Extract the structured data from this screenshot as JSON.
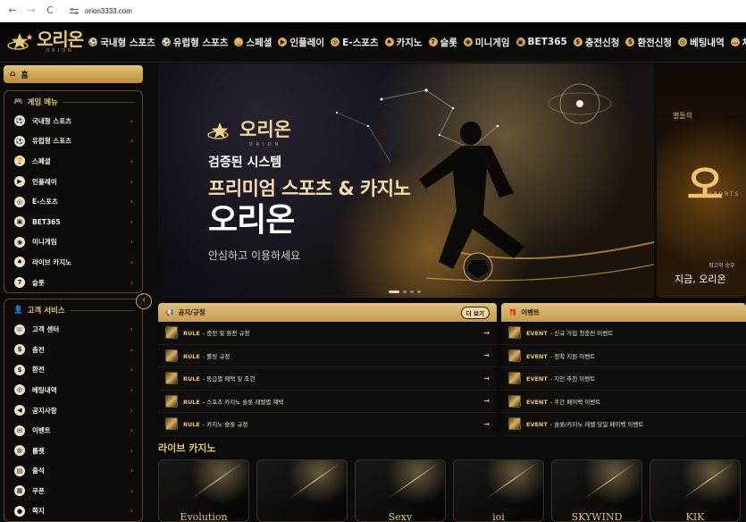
{
  "browser": {
    "url": "orion3333.com",
    "back_icon": "←",
    "forward_icon": "→",
    "reload_icon": "C"
  },
  "header": {
    "logo_ko": "오리온",
    "logo_en": "ORION",
    "menu": [
      {
        "label": "국내형 스포츠",
        "icon": "soccer-ball-icon",
        "glyph": "⚽"
      },
      {
        "label": "유럽형 스포츠",
        "icon": "soccer-ball-icon",
        "glyph": "⚽"
      },
      {
        "label": "스페셜",
        "icon": "trophy-icon",
        "glyph": "🏆"
      },
      {
        "label": "인플레이",
        "icon": "play-icon",
        "glyph": "▶"
      },
      {
        "label": "E-스포츠",
        "icon": "globe-icon",
        "glyph": "◎"
      },
      {
        "label": "카지노",
        "icon": "card-icon",
        "glyph": "♠"
      },
      {
        "label": "슬롯",
        "icon": "seven-icon",
        "glyph": "7"
      },
      {
        "label": "미니게임",
        "icon": "target-icon",
        "glyph": "◉"
      },
      {
        "label": "BET365",
        "icon": "bet365-icon",
        "glyph": "▣"
      },
      {
        "label": "충전신청",
        "icon": "coin-icon",
        "glyph": "$"
      },
      {
        "label": "환전신청",
        "icon": "coin-icon",
        "glyph": "$"
      },
      {
        "label": "베팅내역",
        "icon": "history-icon",
        "glyph": "◎"
      },
      {
        "label": "채",
        "icon": "chat-icon",
        "glyph": "…"
      }
    ]
  },
  "sidebar": {
    "home_label": "홈",
    "game_menu": {
      "title": "게임 메뉴",
      "items": [
        {
          "label": "국내형 스포츠",
          "glyph": "⚽"
        },
        {
          "label": "유럽형 스포츠",
          "glyph": "⚽"
        },
        {
          "label": "스페셜",
          "glyph": "🏆"
        },
        {
          "label": "인플레이",
          "glyph": "▶"
        },
        {
          "label": "E-스포츠",
          "glyph": "◎"
        },
        {
          "label": "BET365",
          "glyph": "▣"
        },
        {
          "label": "미니게임",
          "glyph": "◉"
        },
        {
          "label": "라이브 카지노",
          "glyph": "♠"
        },
        {
          "label": "슬롯",
          "glyph": "7"
        }
      ]
    },
    "service_menu": {
      "title": "고객 서비스",
      "items": [
        {
          "label": "고객 센터",
          "glyph": "☏"
        },
        {
          "label": "충전",
          "glyph": "$"
        },
        {
          "label": "환전",
          "glyph": "$"
        },
        {
          "label": "베팅내역",
          "glyph": "◎"
        },
        {
          "label": "공지사항",
          "glyph": "◀"
        },
        {
          "label": "이벤트",
          "glyph": "✉"
        },
        {
          "label": "룰렛",
          "glyph": "◍"
        },
        {
          "label": "출석",
          "glyph": "▤"
        },
        {
          "label": "쿠폰",
          "glyph": "▦"
        },
        {
          "label": "쪽지",
          "glyph": "●"
        }
      ]
    },
    "chevron": "›",
    "collapse_icon": "‹"
  },
  "hero": {
    "logo_ko": "오리온",
    "logo_en": "ORION",
    "line1": "검증된 시스템",
    "line2": "프리미엄 스포츠 & 카지노",
    "line3": "오리온",
    "line4": "안심하고 이용하세요",
    "next_slide": {
      "line1": "별들의",
      "big": "오",
      "sports": "SPORTS",
      "line3": "최고의 승부",
      "line4": "지금, 오리온"
    }
  },
  "notice": {
    "title": "공지/규정",
    "more": "더 보기",
    "items": [
      {
        "tag": "RULE",
        "title": "- 충전 및 환전 규정"
      },
      {
        "tag": "RULE",
        "title": "- 롤링 규정"
      },
      {
        "tag": "RULE",
        "title": "- 등급별 혜택 및 조건"
      },
      {
        "tag": "RULE",
        "title": "- 스포츠 카지노 슬롯 레벨별 혜택"
      },
      {
        "tag": "RULE",
        "title": "- 카지노 슬롯 규정"
      }
    ]
  },
  "events": {
    "title": "이벤트",
    "items": [
      {
        "tag": "EVENT",
        "title": "- 신규 가입 첫충전 이벤트"
      },
      {
        "tag": "EVENT",
        "title": "- 정착 지원 이벤트"
      },
      {
        "tag": "EVENT",
        "title": "- 지인 추천 이벤트"
      },
      {
        "tag": "EVENT",
        "title": "- 주간 페이백 이벤트"
      },
      {
        "tag": "EVENT",
        "title": "- 슬롯/카지노 레벨 당일 페이백 이벤트"
      }
    ]
  },
  "live_casino": {
    "title": "라이브 카지노",
    "providers": [
      "Evolution",
      "",
      "Sexy",
      "ioi",
      "SKYWIND",
      "KIK"
    ]
  }
}
